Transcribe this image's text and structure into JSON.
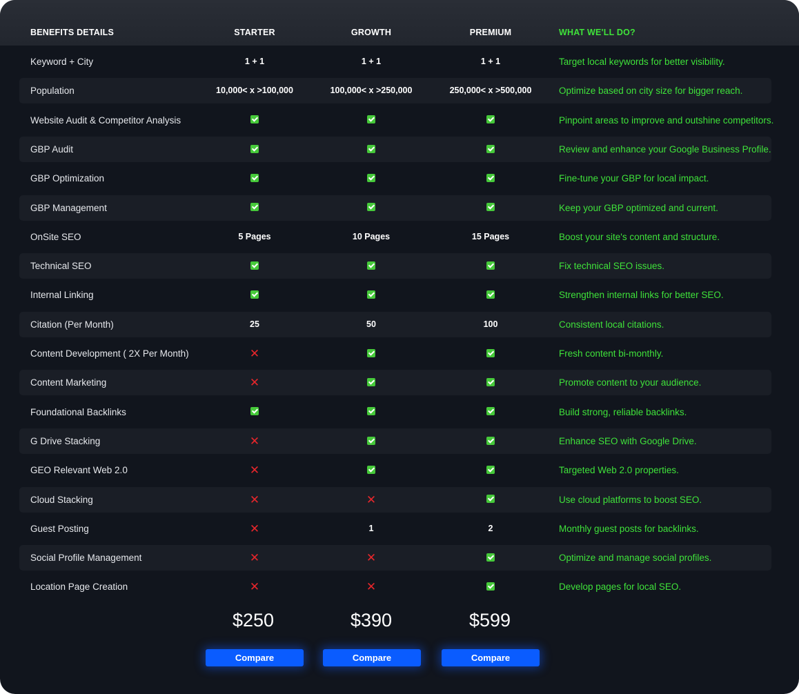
{
  "header": {
    "benefits": "BENEFITS DETAILS",
    "starter": "STARTER",
    "growth": "GROWTH",
    "premium": "PREMIUM",
    "what": "WHAT WE'LL DO?"
  },
  "rows": [
    {
      "name": "Keyword + City",
      "starter": "1 + 1",
      "growth": "1 + 1",
      "premium": "1 + 1",
      "desc": "Target local keywords for better visibility."
    },
    {
      "name": "Population",
      "starter": "10,000< x >100,000",
      "growth": "100,000< x >250,000",
      "premium": "250,000< x >500,000",
      "desc": "Optimize based on city size for bigger reach."
    },
    {
      "name": "Website Audit & Competitor Analysis",
      "starter": "check",
      "growth": "check",
      "premium": "check",
      "desc": "Pinpoint areas to improve and outshine competitors."
    },
    {
      "name": "GBP Audit",
      "starter": "check",
      "growth": "check",
      "premium": "check",
      "desc": "Review and enhance your Google Business Profile."
    },
    {
      "name": "GBP Optimization",
      "starter": "check",
      "growth": "check",
      "premium": "check",
      "desc": "Fine-tune your GBP for local impact."
    },
    {
      "name": "GBP Management",
      "starter": "check",
      "growth": "check",
      "premium": "check",
      "desc": "Keep your GBP optimized and current."
    },
    {
      "name": "OnSite SEO",
      "starter": "5 Pages",
      "growth": "10 Pages",
      "premium": "15 Pages",
      "desc": "Boost your site's content and structure."
    },
    {
      "name": "Technical SEO",
      "starter": "check",
      "growth": "check",
      "premium": "check",
      "desc": "Fix technical SEO issues."
    },
    {
      "name": "Internal Linking",
      "starter": "check",
      "growth": "check",
      "premium": "check",
      "desc": "Strengthen internal links for better SEO."
    },
    {
      "name": "Citation (Per Month)",
      "starter": "25",
      "growth": "50",
      "premium": "100",
      "desc": "Consistent local citations."
    },
    {
      "name": "Content Development ( 2X Per Month)",
      "starter": "cross",
      "growth": "check",
      "premium": "check",
      "desc": "Fresh content bi-monthly."
    },
    {
      "name": "Content Marketing",
      "starter": "cross",
      "growth": "check",
      "premium": "check",
      "desc": "Promote content to your audience."
    },
    {
      "name": "Foundational Backlinks",
      "starter": "check",
      "growth": "check",
      "premium": "check",
      "desc": "Build strong, reliable backlinks."
    },
    {
      "name": "G Drive Stacking",
      "starter": "cross",
      "growth": "check",
      "premium": "check",
      "desc": "Enhance SEO with Google Drive."
    },
    {
      "name": "GEO Relevant Web 2.0",
      "starter": "cross",
      "growth": "check",
      "premium": "check",
      "desc": "Targeted Web 2.0 properties."
    },
    {
      "name": "Cloud Stacking",
      "starter": "cross",
      "growth": "cross",
      "premium": "check",
      "desc": "Use cloud platforms to boost SEO."
    },
    {
      "name": "Guest Posting",
      "starter": "cross",
      "growth": "1",
      "premium": "2",
      "desc": "Monthly guest posts for backlinks."
    },
    {
      "name": "Social Profile Management",
      "starter": "cross",
      "growth": "cross",
      "premium": "check",
      "desc": "Optimize and manage social profiles."
    },
    {
      "name": "Location Page Creation",
      "starter": "cross",
      "growth": "cross",
      "premium": "check",
      "desc": "Develop pages for local SEO."
    }
  ],
  "prices": {
    "starter": "$250",
    "growth": "$390",
    "premium": "$599"
  },
  "buttons": {
    "starter": "Compare",
    "growth": "Compare",
    "premium": "Compare"
  },
  "colors": {
    "accent_green": "#3fe23a",
    "button_blue": "#0a5cff",
    "cross_red": "#e8262b",
    "check_green": "#46c93a"
  }
}
